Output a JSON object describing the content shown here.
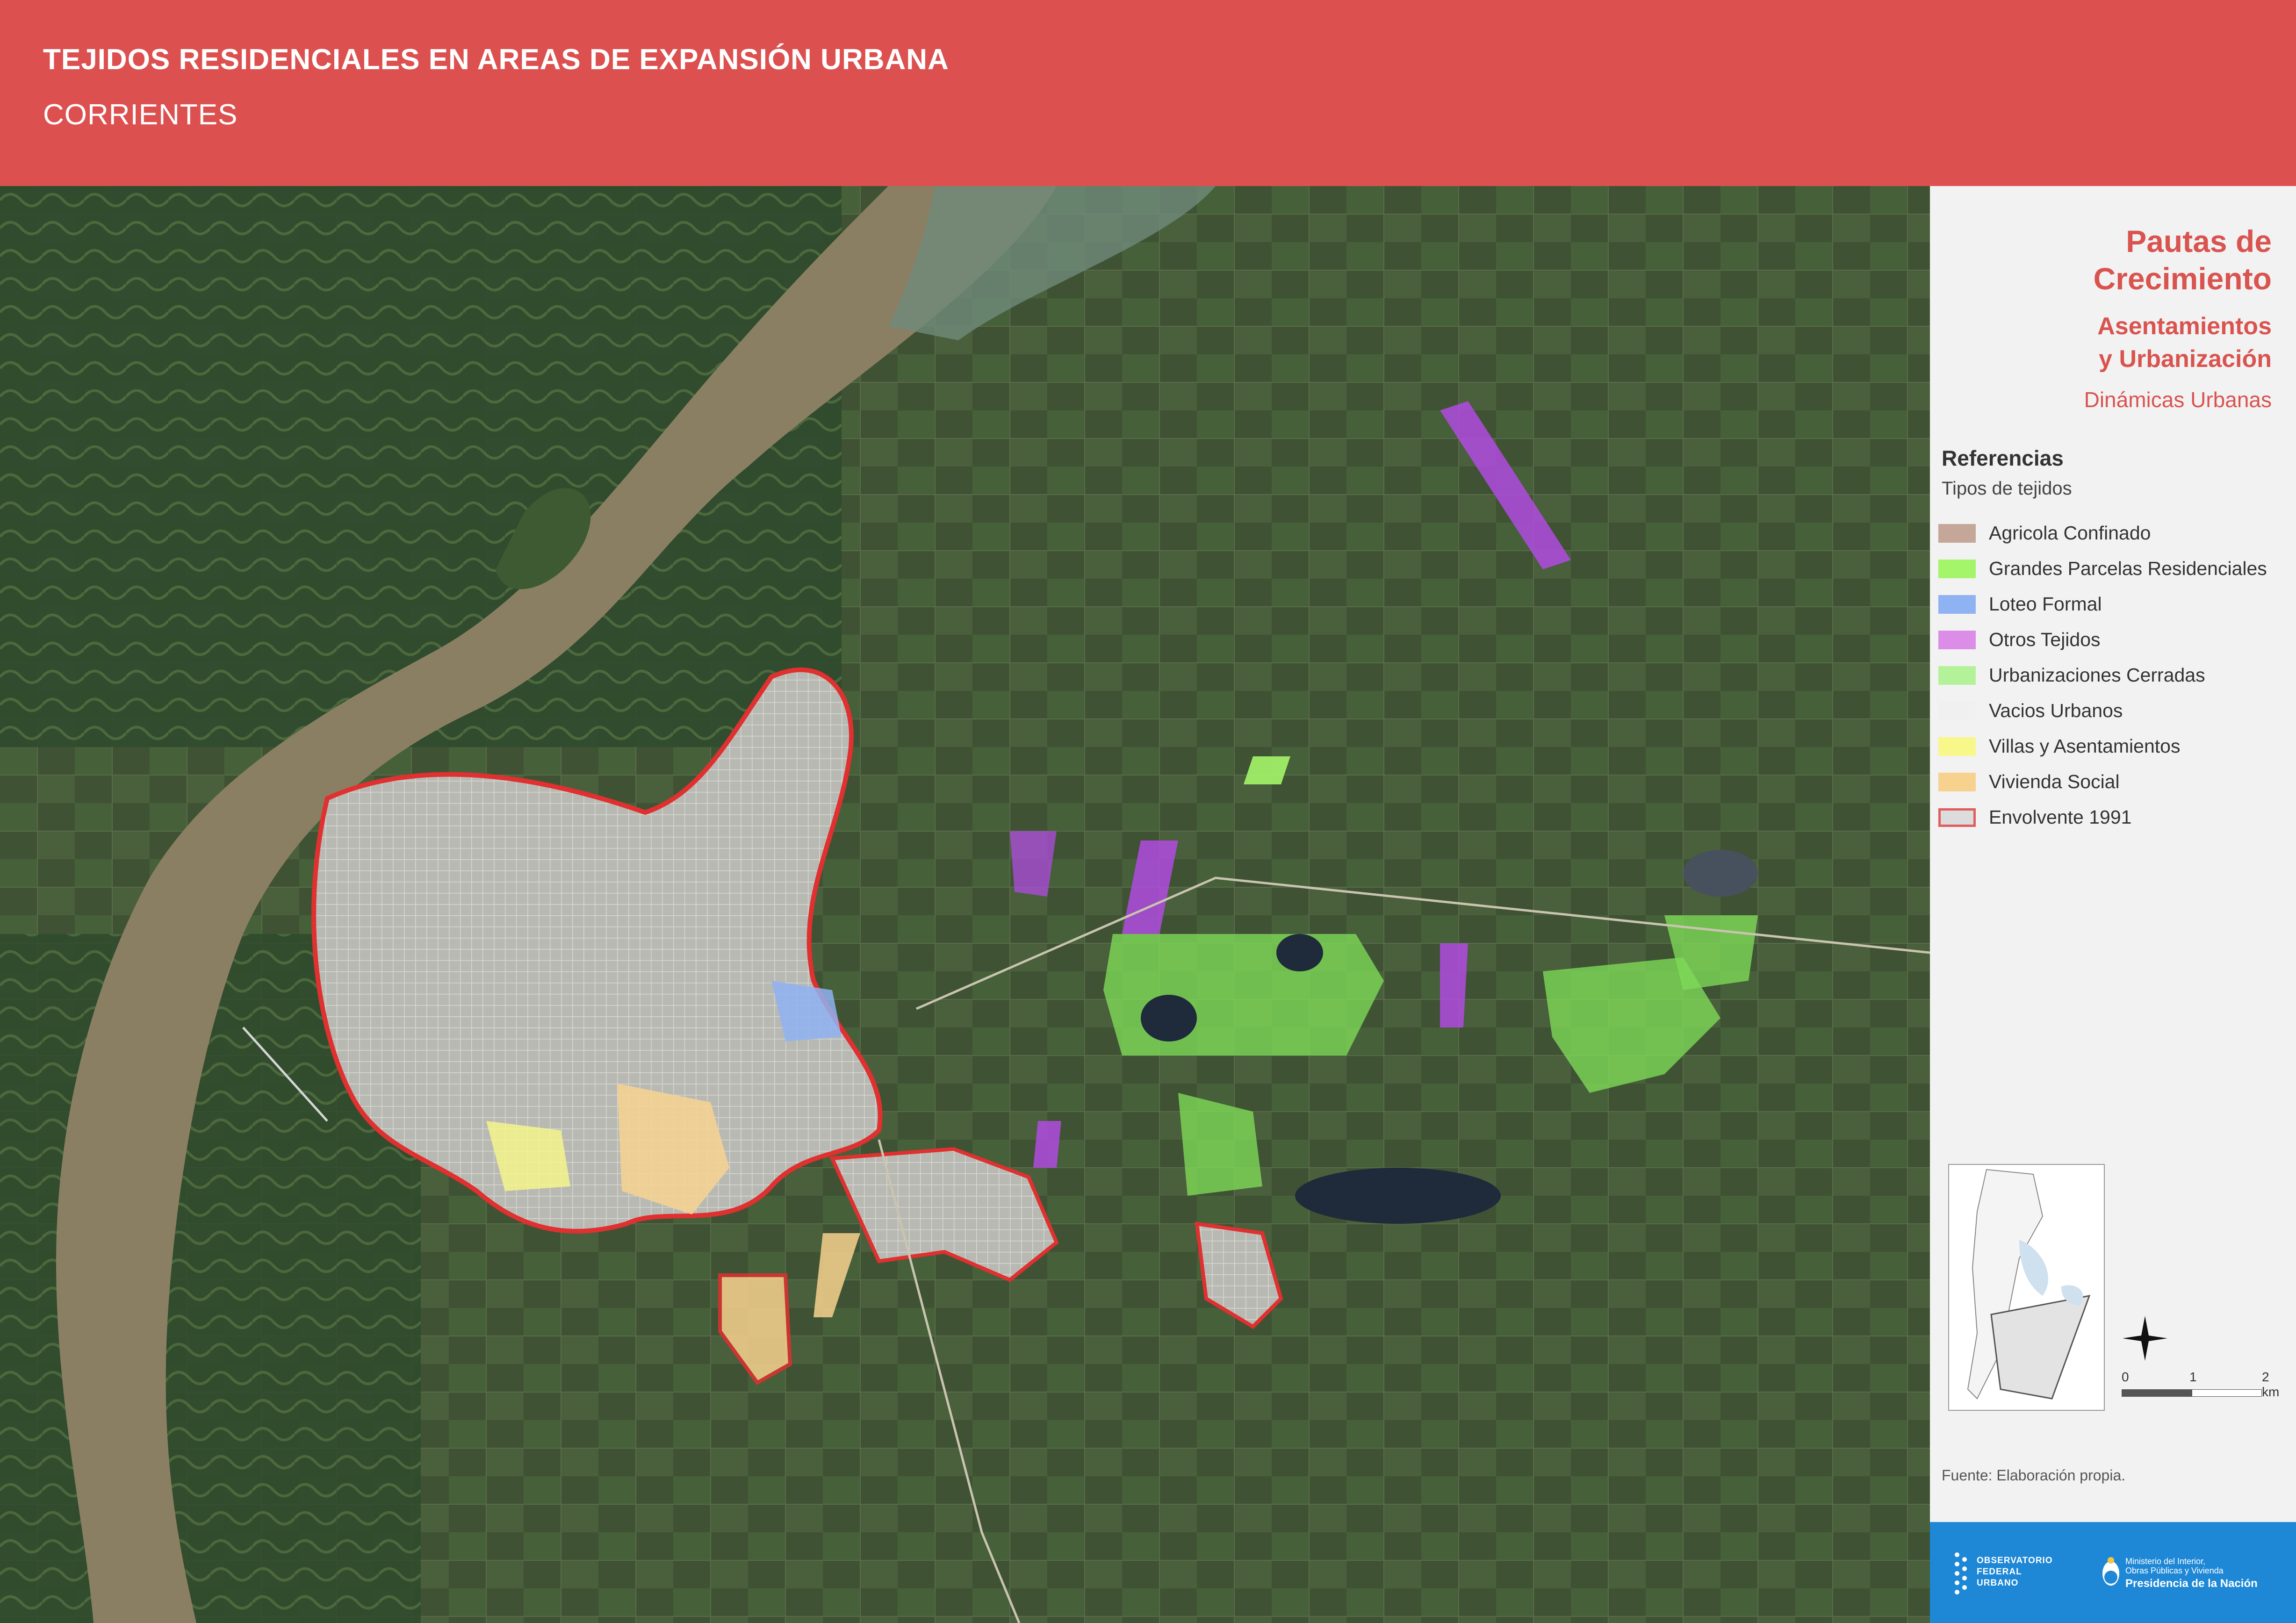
{
  "header": {
    "title": "TEJIDOS RESIDENCIALES EN AREAS DE EXPANSIÓN URBANA",
    "subtitle": "CORRIENTES"
  },
  "panel": {
    "title_line1": "Pautas de",
    "title_line2": "Crecimiento",
    "section_line1": "Asentamientos",
    "section_line2": "y Urbanización",
    "category": "Dinámicas Urbanas"
  },
  "legend": {
    "title": "Referencias",
    "subtitle": "Tipos de tejidos",
    "items": [
      {
        "label": "Agricola Confinado",
        "color": "#c4a798",
        "border": "#c4a798"
      },
      {
        "label": "Grandes Parcelas Residenciales",
        "color": "#a5f56a",
        "border": "#a5f56a"
      },
      {
        "label": "Loteo Formal",
        "color": "#8fb2f2",
        "border": "#8fb2f2"
      },
      {
        "label": "Otros Tejidos",
        "color": "#db8de8",
        "border": "#db8de8"
      },
      {
        "label": "Urbanizaciones Cerradas",
        "color": "#b4f29a",
        "border": "#b4f29a"
      },
      {
        "label": "Vacios Urbanos",
        "color": "#f0f0f0",
        "border": "#f0f0f0"
      },
      {
        "label": "Villas y Asentamientos",
        "color": "#f7f78a",
        "border": "#f7f78a"
      },
      {
        "label": "Vivienda Social",
        "color": "#f7d28f",
        "border": "#f7d28f"
      },
      {
        "label": "Envolvente 1991",
        "color": "#dcdcdc",
        "border": "#e05d5d"
      }
    ]
  },
  "scale": {
    "labels": [
      "0",
      "1",
      "2 km"
    ]
  },
  "source": "Fuente: Elaboración propia.",
  "footer": {
    "observatorio": [
      "OBSERVATORIO",
      "FEDERAL",
      "URBANO"
    ],
    "ministerio_line1": "Ministerio del Interior,",
    "ministerio_line2": "Obras Públicas y Vivienda",
    "presidencia": "Presidencia de la Nación"
  },
  "colors": {
    "header_bg": "#dc5150",
    "accent_red": "#d9534f",
    "footer_blue": "#1e88d6",
    "envolvente": "#e03030",
    "river": "#8a7f63"
  }
}
